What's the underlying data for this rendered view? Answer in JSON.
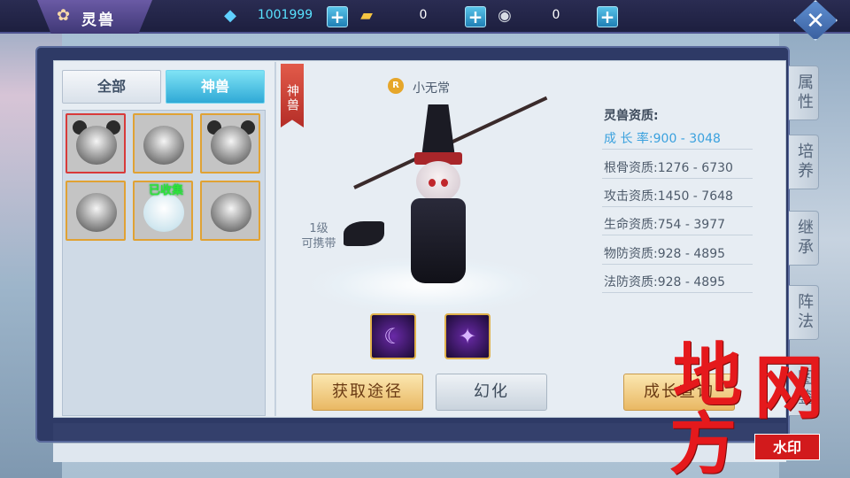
{
  "header": {
    "title": "灵兽",
    "resources": [
      {
        "icon": "diamond-icon",
        "value": "1001999"
      },
      {
        "icon": "gold-ingot-icon",
        "value": "0"
      },
      {
        "icon": "silver-coin-icon",
        "value": "0"
      }
    ]
  },
  "left": {
    "tabs": [
      {
        "label": "全部",
        "active": false
      },
      {
        "label": "神兽",
        "active": true
      }
    ],
    "collected_tag": "已收集",
    "pets": [
      {
        "name": "bear",
        "selected_red": true
      },
      {
        "name": "xiao-wu-chang",
        "selected_red": false
      },
      {
        "name": "panda",
        "selected_red": false
      },
      {
        "name": "monkey",
        "selected_red": false
      },
      {
        "name": "white-rabbit",
        "selected_red": false,
        "collected": true
      },
      {
        "name": "fox",
        "selected_red": false
      }
    ]
  },
  "center": {
    "ribbon": "神兽",
    "rank_badge": "ⓘ",
    "pet_name": "小无常",
    "level_line1": "1级",
    "level_line2": "可携带",
    "skills": [
      "skill-scythe-icon",
      "skill-witch-icon"
    ],
    "buttons": {
      "acquire": "获取途径",
      "transform": "幻化",
      "growth": "成长查询"
    }
  },
  "stats": {
    "header": "灵兽资质:",
    "rows": [
      {
        "label": "成 长 率:",
        "value": "900  -  3048",
        "highlight": true
      },
      {
        "label": "根骨资质:",
        "value": "1276  -  6730"
      },
      {
        "label": "攻击资质:",
        "value": "1450  -  7648"
      },
      {
        "label": "生命资质:",
        "value": "754    -  3977"
      },
      {
        "label": "物防资质:",
        "value": "928    -  4895"
      },
      {
        "label": "法防资质:",
        "value": "928    -  4895"
      }
    ]
  },
  "side_tabs": [
    "属性",
    "培养",
    "继承",
    "阵法",
    "图鉴"
  ],
  "watermark": {
    "big1": "地",
    "big2": "网",
    "big3": "方",
    "box": "水印"
  }
}
